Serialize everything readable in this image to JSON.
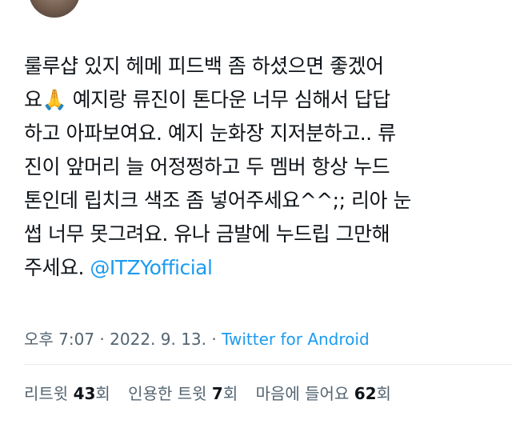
{
  "tweet": {
    "line1": "룰루샵 있지 헤메 피드백 좀 하셨으면 좋겠어",
    "line2": "요🙏 예지랑 류진이 톤다운 너무 심해서 답답",
    "line3": "하고 아파보여요. 예지 눈화장 지저분하고.. 류",
    "line4": "진이 앞머리 늘 어정쩡하고 두 멤버 항상 누드",
    "line5": "톤인데 립치크 색조 좀 넣어주세요^^;; 리아 눈",
    "line6": "썹 너무 못그려요. 유나 금발에 누드립 그만해",
    "line7_prefix": "주세요. ",
    "mention": "@ITZYofficial"
  },
  "meta": {
    "time_date": "오후 7:07 · 2022. 9. 13. · ",
    "source": "Twitter for Android"
  },
  "stats": {
    "retweets_label": "리트윗 ",
    "retweets_count": "43",
    "retweets_unit": "회",
    "quotes_label": "인용한 트윗 ",
    "quotes_count": "7",
    "quotes_unit": "회",
    "likes_label": "마음에 들어요 ",
    "likes_count": "62",
    "likes_unit": "회"
  },
  "colors": {
    "link": "#1d9bf0",
    "secondary_text": "#536471",
    "primary_text": "#0f1419"
  }
}
